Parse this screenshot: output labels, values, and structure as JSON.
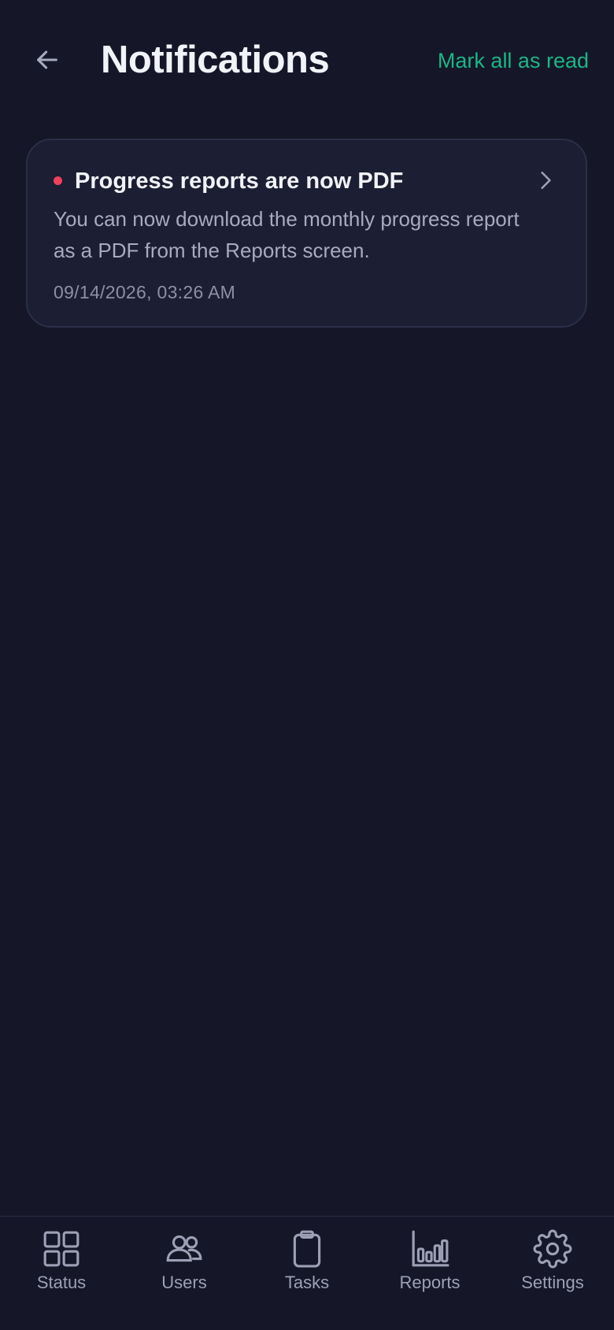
{
  "header": {
    "title": "Notifications",
    "mark_all_label": "Mark all as read",
    "back_icon": "arrow-left-icon"
  },
  "notifications": [
    {
      "title": "Progress reports are now PDF",
      "body": "You can now download the monthly progress report as a PDF from the Reports screen.",
      "timestamp": "09/14/2026, 03:26 AM",
      "unread": true
    }
  ],
  "tabbar": {
    "items": [
      {
        "label": "Status",
        "icon": "grid-icon"
      },
      {
        "label": "Users",
        "icon": "users-icon"
      },
      {
        "label": "Tasks",
        "icon": "clipboard-icon"
      },
      {
        "label": "Reports",
        "icon": "bar-chart-icon"
      },
      {
        "label": "Settings",
        "icon": "gear-icon"
      }
    ]
  },
  "colors": {
    "background": "#151729",
    "card": "#1c1e33",
    "accent": "#1db584",
    "unread_dot": "#f0405c",
    "muted_text": "#a8abbf"
  }
}
